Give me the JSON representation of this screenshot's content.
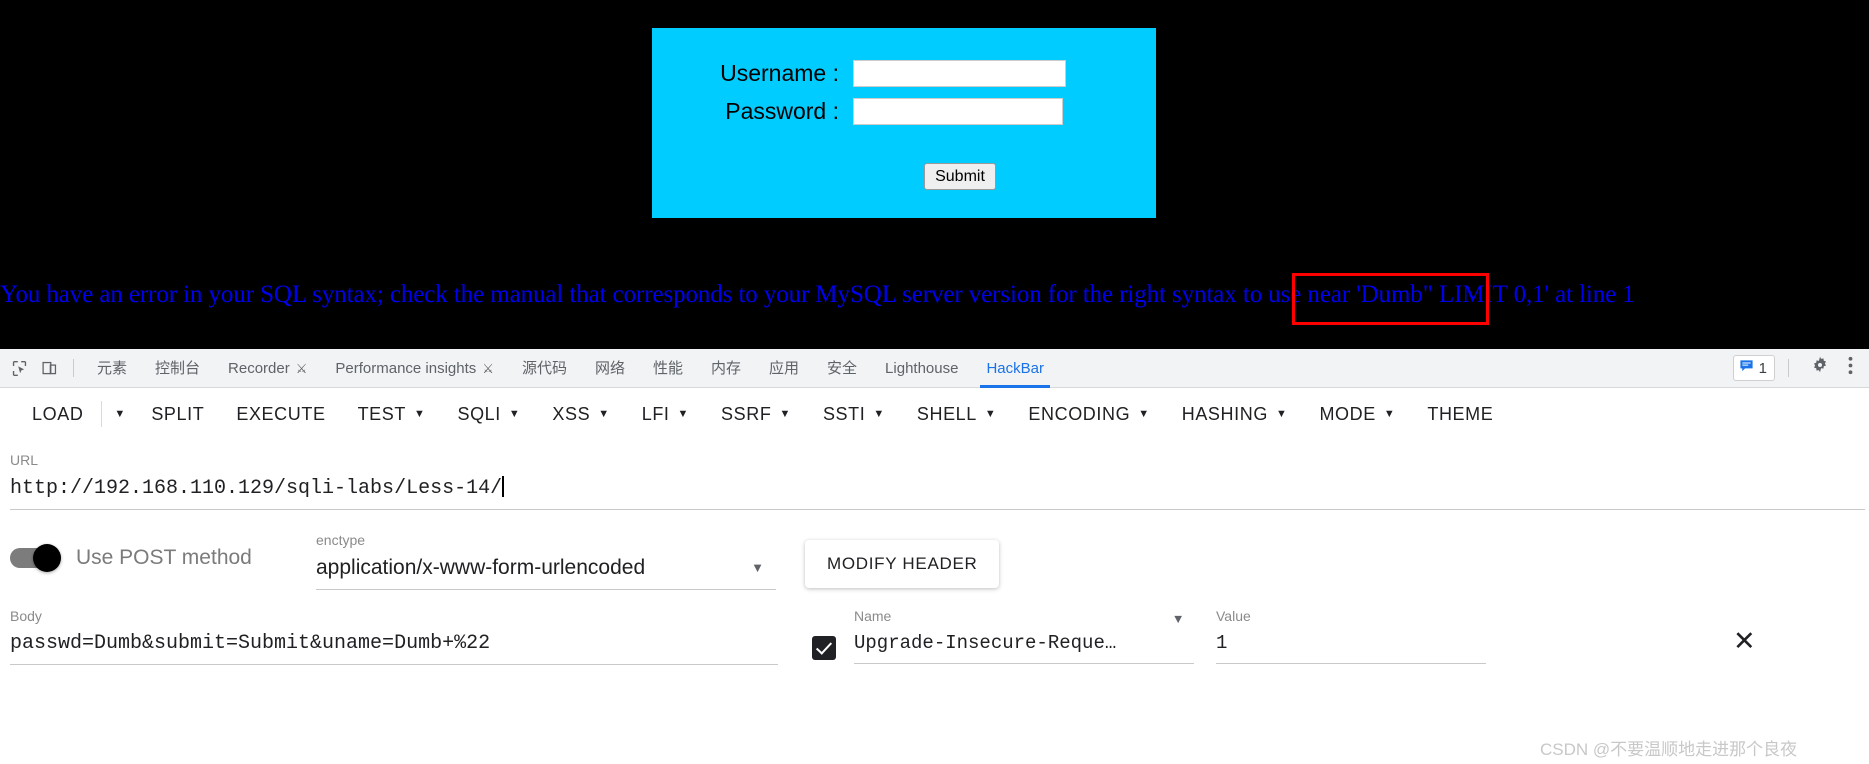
{
  "page": {
    "login_form": {
      "username_label": "Username :",
      "password_label": "Password :",
      "submit_label": "Submit",
      "background_color": "#00ccff",
      "username_value": "",
      "password_value": ""
    },
    "sql_error": "You have an error in your SQL syntax; check the manual that corresponds to your MySQL server version for the right syntax to use near 'Dumb\" LIMIT 0,1' at line 1",
    "highlight_text": "'Dumb\" LIMIT 0,1'",
    "highlight_color": "#ff0000",
    "page_background": "#000000"
  },
  "devtools": {
    "inspect_icon": "cursor-select-icon",
    "device_icon": "device-toolbar-icon",
    "tabs": [
      {
        "label": "元素",
        "active": false,
        "experimental": false
      },
      {
        "label": "控制台",
        "active": false,
        "experimental": false
      },
      {
        "label": "Recorder",
        "active": false,
        "experimental": true
      },
      {
        "label": "Performance insights",
        "active": false,
        "experimental": true
      },
      {
        "label": "源代码",
        "active": false,
        "experimental": false
      },
      {
        "label": "网络",
        "active": false,
        "experimental": false
      },
      {
        "label": "性能",
        "active": false,
        "experimental": false
      },
      {
        "label": "内存",
        "active": false,
        "experimental": false
      },
      {
        "label": "应用",
        "active": false,
        "experimental": false
      },
      {
        "label": "安全",
        "active": false,
        "experimental": false
      },
      {
        "label": "Lighthouse",
        "active": false,
        "experimental": false
      },
      {
        "label": "HackBar",
        "active": true,
        "experimental": false
      }
    ],
    "message_count": "1",
    "message_icon": "message-icon",
    "settings_icon": "gear-icon",
    "more_icon": "kebab-menu-icon",
    "active_tab_color": "#1a73e8"
  },
  "hackbar": {
    "buttons": [
      {
        "label": "LOAD",
        "caret": false,
        "split_caret": true
      },
      {
        "label": "SPLIT",
        "caret": false,
        "split_caret": false
      },
      {
        "label": "EXECUTE",
        "caret": false,
        "split_caret": false
      },
      {
        "label": "TEST",
        "caret": true,
        "split_caret": false
      },
      {
        "label": "SQLI",
        "caret": true,
        "split_caret": false
      },
      {
        "label": "XSS",
        "caret": true,
        "split_caret": false
      },
      {
        "label": "LFI",
        "caret": true,
        "split_caret": false
      },
      {
        "label": "SSRF",
        "caret": true,
        "split_caret": false
      },
      {
        "label": "SSTI",
        "caret": true,
        "split_caret": false
      },
      {
        "label": "SHELL",
        "caret": true,
        "split_caret": false
      },
      {
        "label": "ENCODING",
        "caret": true,
        "split_caret": false
      },
      {
        "label": "HASHING",
        "caret": true,
        "split_caret": false
      },
      {
        "label": "MODE",
        "caret": true,
        "split_caret": false
      },
      {
        "label": "THEME",
        "caret": false,
        "split_caret": false
      }
    ],
    "url": {
      "label": "URL",
      "value": "http://192.168.110.129/sqli-labs/Less-14/"
    },
    "post_toggle": {
      "label": "Use POST method",
      "enabled": true
    },
    "enctype": {
      "label": "enctype",
      "value": "application/x-www-form-urlencoded"
    },
    "modify_header_label": "MODIFY HEADER",
    "body": {
      "label": "Body",
      "value": "passwd=Dumb&submit=Submit&uname=Dumb+%22"
    },
    "header_row": {
      "name_label": "Name",
      "value_label": "Value",
      "name": "Upgrade-Insecure-Reque…",
      "value": "1",
      "checked": true,
      "close_icon": "close-icon"
    }
  },
  "watermark": "CSDN @不要温顺地走进那个良夜"
}
